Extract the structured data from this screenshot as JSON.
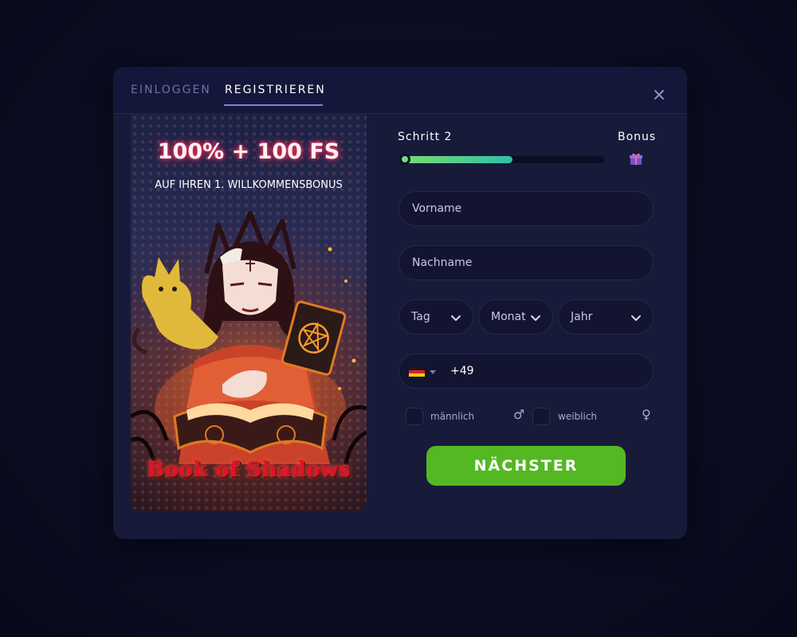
{
  "header": {
    "tabs": [
      {
        "label": "EINLOGGEN",
        "active": false
      },
      {
        "label": "REGISTRIEREN",
        "active": true
      }
    ],
    "close_icon": "close-icon"
  },
  "promo": {
    "title": "100% + 100 FS",
    "subtitle": "AUF IHREN 1. WILLKOMMENSBONUS",
    "game_title": "Book of Shadows"
  },
  "form": {
    "step_label": "Schritt 2",
    "bonus_label": "Bonus",
    "progress": 0.55,
    "first_name_placeholder": "Vorname",
    "last_name_placeholder": "Nachname",
    "day_label": "Tag",
    "month_label": "Monat",
    "year_label": "Jahr",
    "phone_prefix": "+49",
    "country_flag": "flag-de-icon",
    "gender_male_label": "männlich",
    "gender_female_label": "weiblich",
    "next_button": "NÄCHSTER"
  },
  "colors": {
    "modal_bg": "#181a3a",
    "accent": "#7b7fea",
    "button": "#54b822",
    "progress": "#2fbfa6"
  }
}
